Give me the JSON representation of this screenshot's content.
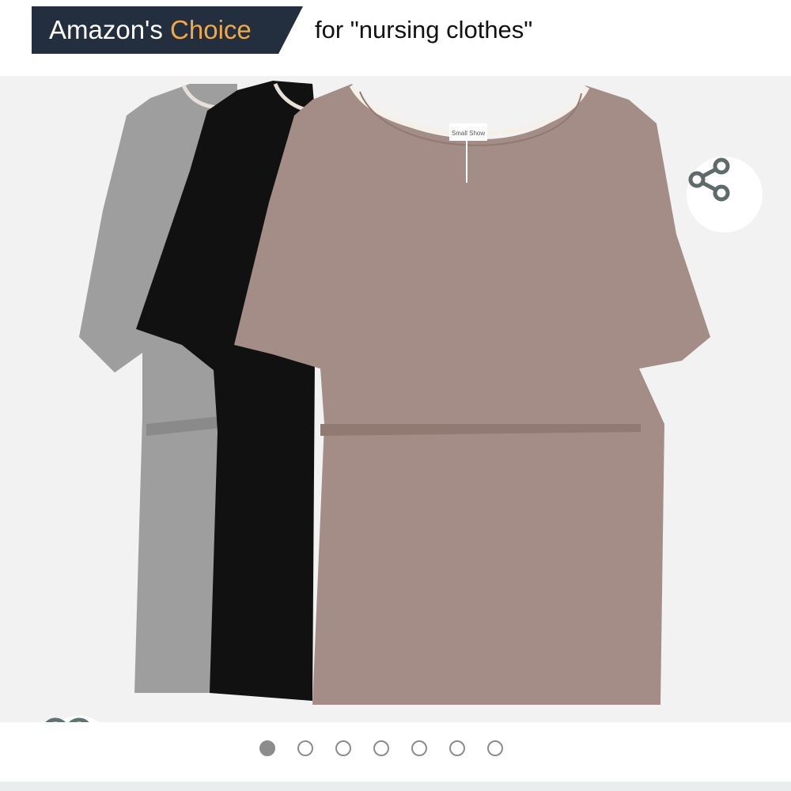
{
  "badge": {
    "brand_label": "Amazon's",
    "choice_label": "Choice",
    "query_text": "for \"nursing clothes\"",
    "colors": {
      "badge_bg": "#232f3e",
      "choice_text": "#f3a847"
    }
  },
  "product_image": {
    "icons": {
      "share": "share-icon",
      "wishlist": "heart-outline-icon"
    },
    "tag_text": "Small Show"
  },
  "carousel": {
    "total_images": 7,
    "active_index": 1
  }
}
